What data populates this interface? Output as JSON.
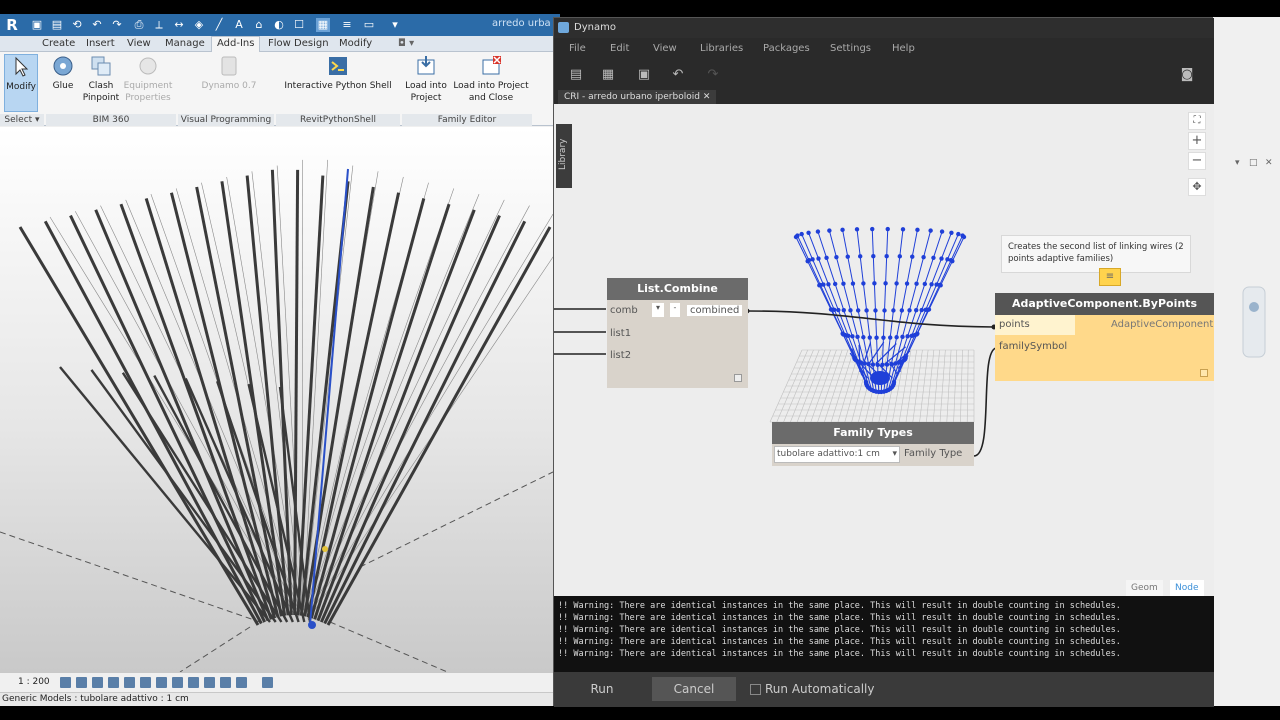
{
  "revit": {
    "doc_title": "arredo urba",
    "tabs": [
      "Create",
      "Insert",
      "View",
      "Manage",
      "Add-Ins",
      "Flow Design",
      "Modify"
    ],
    "active_tab": "Add-Ins",
    "buttons": {
      "modify": "Modify",
      "glue": "Glue",
      "clash_pinpoint": "Clash Pinpoint",
      "equipment_properties": "Equipment Properties",
      "dynamo": "Dynamo 0.7",
      "interactive_python_shell": "Interactive Python Shell",
      "load_into_project": "Load into Project",
      "load_into_project_and_close": "Load into Project and Close"
    },
    "panels": {
      "select": "Select ▾",
      "bim360": "BIM 360",
      "visual_programming": "Visual Programming",
      "revit_python_shell": "RevitPythonShell",
      "family_editor": "Family Editor"
    },
    "scale": "1 : 200",
    "status": "Generic Models : tubolare adattivo : 1 cm"
  },
  "dynamo": {
    "title": "Dynamo",
    "menus": [
      "File",
      "Edit",
      "View",
      "Libraries",
      "Packages",
      "Settings",
      "Help"
    ],
    "tab": "CRI - arredo urbano iperboloid",
    "library_label": "Library",
    "nodes": {
      "list_combine": {
        "title": "List.Combine",
        "ports_in": [
          "comb",
          "list1",
          "list2"
        ],
        "port_out": "combined"
      },
      "family_types": {
        "title": "Family Types",
        "selected": "tubolare adattivo:1 cm",
        "port_out": "Family Type"
      },
      "adaptive": {
        "title": "AdaptiveComponent.ByPoints",
        "ports_in": [
          "points",
          "familySymbol"
        ],
        "port_out": "AdaptiveComponent"
      }
    },
    "note": "Creates the second list of linking wires (2 points adaptive families)",
    "view_toggle": {
      "geom": "Geom",
      "node": "Node"
    },
    "console_lines": [
      "!! Warning: There are identical instances in the same place. This will result in double counting in schedules.",
      "!! Warning: There are identical instances in the same place. This will result in double counting in schedules.",
      "!! Warning: There are identical instances in the same place. This will result in double counting in schedules.",
      "!! Warning: There are identical instances in the same place. This will result in double counting in schedules.",
      "!! Warning: There are identical instances in the same place. This will result in double counting in schedules."
    ],
    "run_label": "Run",
    "cancel_label": "Cancel",
    "run_auto_label": "Run Automatically"
  },
  "colors": {
    "revit_blue": "#2b6ba8",
    "node_header": "#6b6b6b",
    "node_body": "#d9d3cb",
    "adaptive_body": "#ffd98a",
    "adaptive_header": "#555555",
    "preview_blue": "#1f3fd8"
  }
}
